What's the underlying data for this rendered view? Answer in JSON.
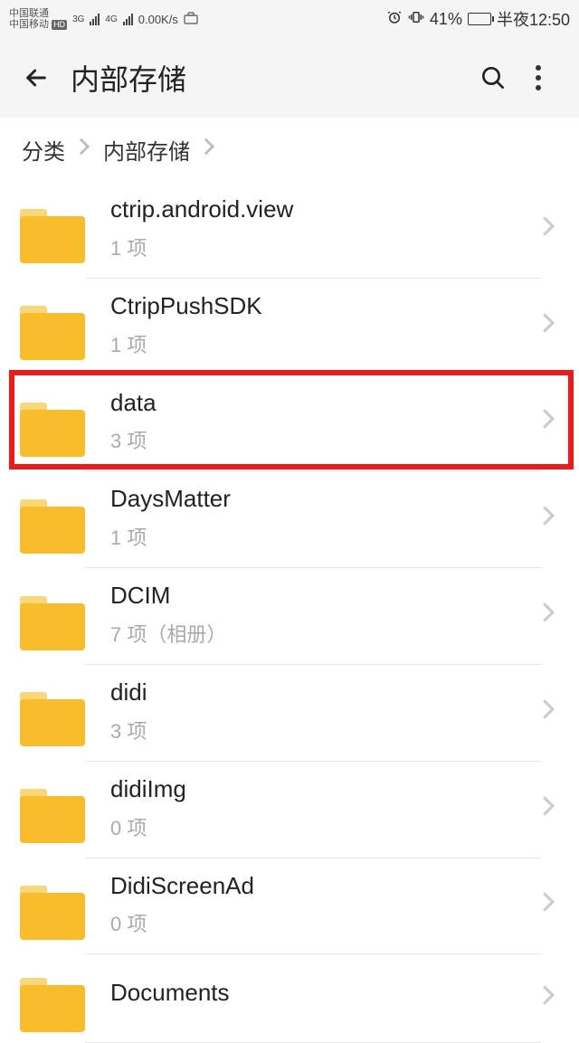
{
  "status": {
    "carrier1": "中国联通",
    "carrier2": "中国移动",
    "net1": "3G",
    "net2": "4G",
    "speed": "0.00K/s",
    "battery_pct": "41%",
    "time": "半夜12:50"
  },
  "appbar": {
    "title": "内部存储"
  },
  "breadcrumb": {
    "root": "分类",
    "current": "内部存储"
  },
  "folders": [
    {
      "name": "ctrip.android.view",
      "meta": "1 项",
      "highlight": false
    },
    {
      "name": "CtripPushSDK",
      "meta": "1 项",
      "highlight": false
    },
    {
      "name": "data",
      "meta": "3 项",
      "highlight": true
    },
    {
      "name": "DaysMatter",
      "meta": "1 项",
      "highlight": false
    },
    {
      "name": "DCIM",
      "meta": "7 项（相册）",
      "highlight": false
    },
    {
      "name": "didi",
      "meta": "3 项",
      "highlight": false
    },
    {
      "name": "didiImg",
      "meta": "0 项",
      "highlight": false
    },
    {
      "name": "DidiScreenAd",
      "meta": "0 项",
      "highlight": false
    },
    {
      "name": "Documents",
      "meta": "",
      "highlight": false
    }
  ]
}
